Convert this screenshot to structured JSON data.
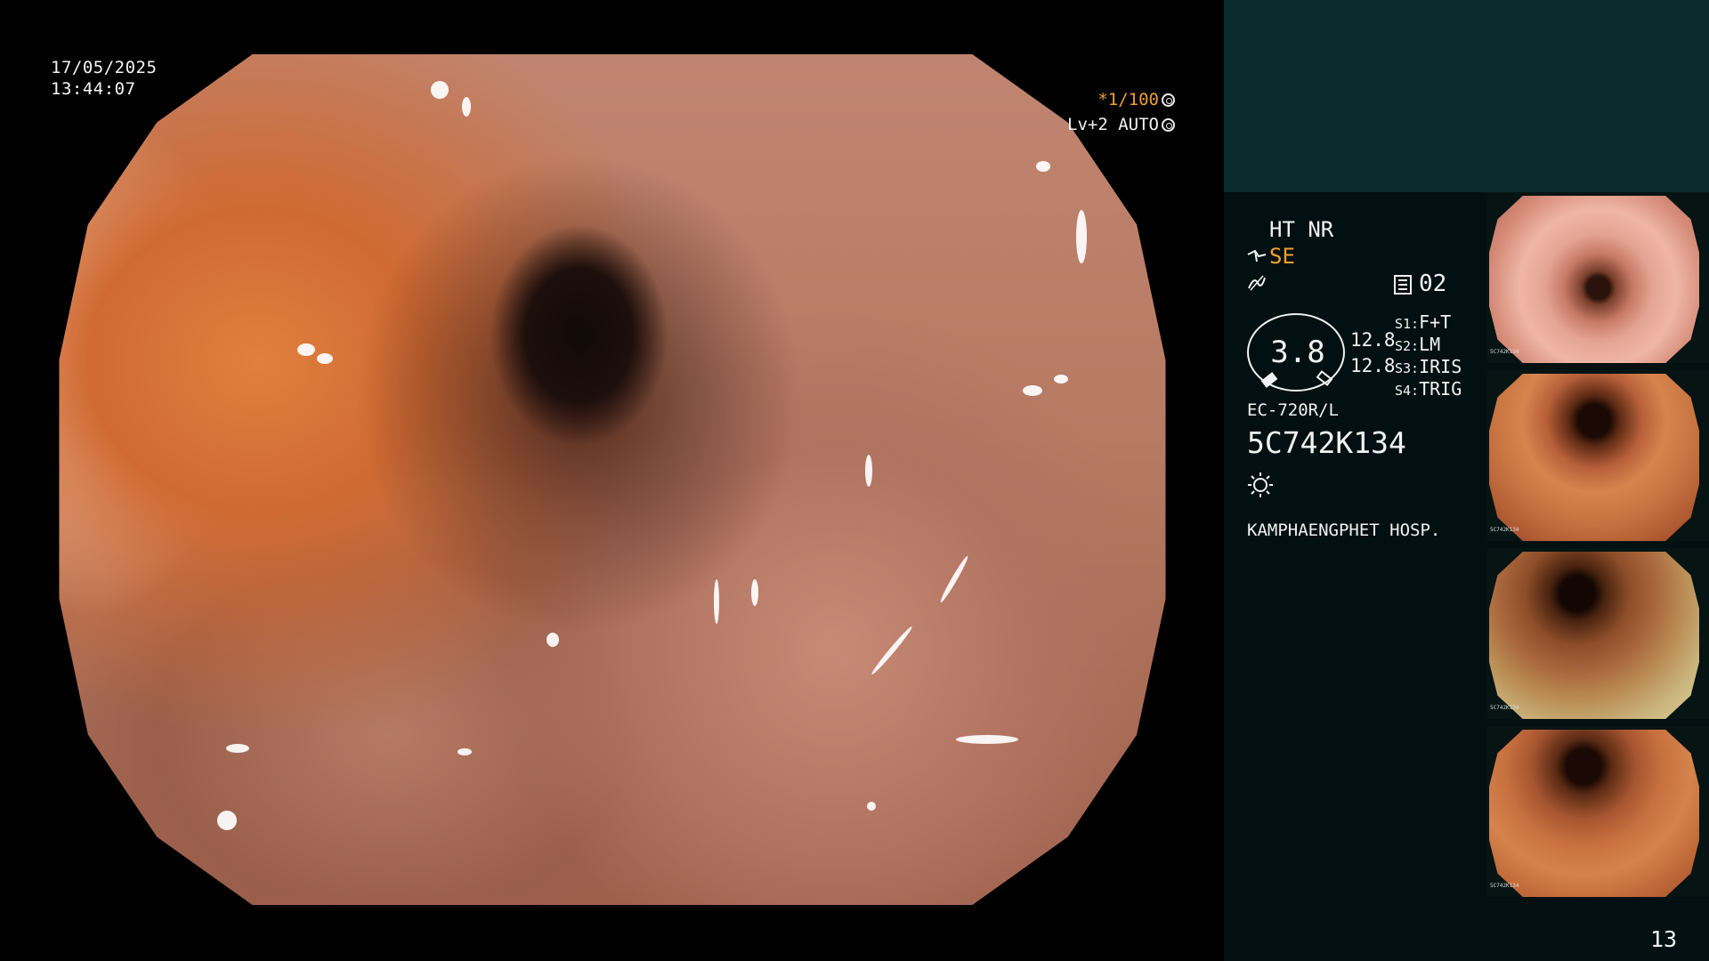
{
  "screen": {
    "date": "17/05/2025",
    "time": "13:44:07",
    "shutter": "*1/100",
    "iris_mode": "Lv+2 AUTO"
  },
  "settings": {
    "ht_nr": "HT NR",
    "se_label": "SE",
    "memo_number": "02",
    "gauge_value": "3.8",
    "val1": "12.8",
    "val2": "12.8",
    "s1_key": "S1:",
    "s1_val": "F+T",
    "s2_key": "S2:",
    "s2_val": "LM",
    "s3_key": "S3:",
    "s3_val": "IRIS",
    "s4_key": "S4:",
    "s4_val": "TRIG",
    "scope_model": "EC-720R/L",
    "serial": "5C742K134",
    "hospital": "KAMPHAENGPHET HOSP."
  },
  "thumbnails": [
    {
      "label": "5C742K134"
    },
    {
      "label": "5C742K134"
    },
    {
      "label": "5C742K134"
    },
    {
      "label": "5C742K134"
    }
  ],
  "page_number": "13",
  "colors": {
    "panel_bg": "#031011",
    "panel_top_bg": "#0a2c2c",
    "accent_orange": "#f0a030",
    "hud_text": "#f4f4f4"
  },
  "icons": [
    "shutter-icon",
    "auto-iris-icon",
    "memo-icon",
    "lamp-icon",
    "se-icon",
    "nr-icon"
  ]
}
